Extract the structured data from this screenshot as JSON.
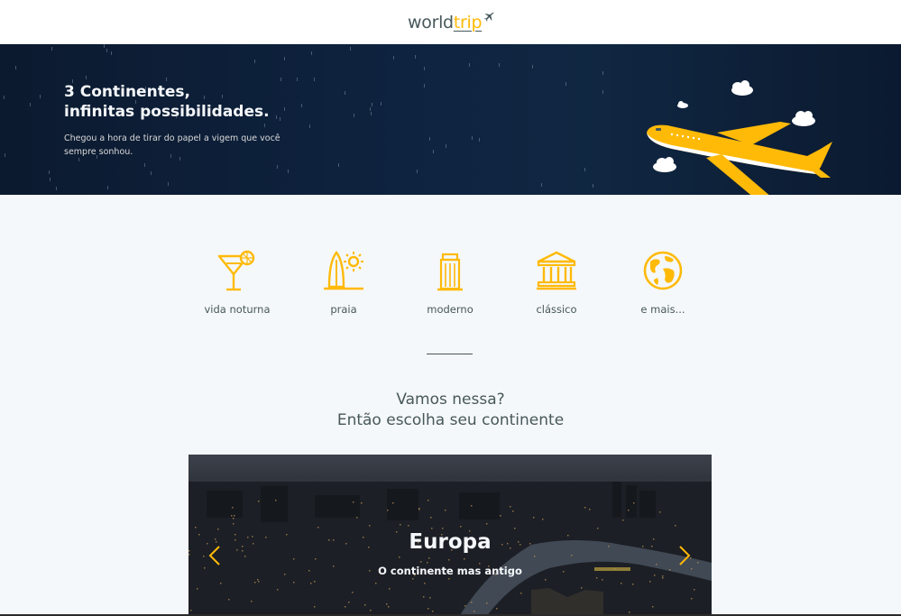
{
  "header": {
    "logo_world": "world",
    "logo_trip": "trip",
    "logo_icon": "airplane-icon"
  },
  "banner": {
    "title_line1": "3 Continentes,",
    "title_line2": "infinitas possibilidades.",
    "subtitle": "Chegou a hora de tirar do papel a vigem que você sempre sonhou.",
    "art_icon": "airplane-illustration"
  },
  "travel_types": [
    {
      "label": "vida noturna",
      "icon": "cocktail-icon"
    },
    {
      "label": "praia",
      "icon": "surfboard-sun-icon"
    },
    {
      "label": "moderno",
      "icon": "skyscraper-icon"
    },
    {
      "label": "clássico",
      "icon": "museum-icon"
    },
    {
      "label": "e mais...",
      "icon": "globe-icon"
    }
  ],
  "cta": {
    "line1": "Vamos nessa?",
    "line2": "Então escolha seu continente"
  },
  "slider": {
    "title": "Europa",
    "subtitle": "O continente mas antigo",
    "prev_icon": "chevron-left-icon",
    "next_icon": "chevron-right-icon"
  },
  "colors": {
    "accent": "#ffba08",
    "text_dark": "#47585b",
    "background": "#f5f8fa",
    "banner_bg": "#0e2340"
  }
}
